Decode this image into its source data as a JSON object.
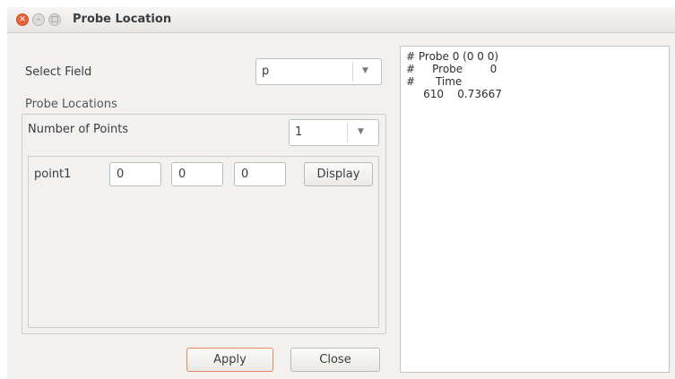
{
  "window": {
    "title": "Probe Location"
  },
  "select_field": {
    "label": "Select Field",
    "value": "p"
  },
  "probe_locations": {
    "label": "Probe Locations",
    "number_of_points_label": "Number of Points",
    "number_of_points_value": "1",
    "points": [
      {
        "label": "point1",
        "x": "0",
        "y": "0",
        "z": "0",
        "display_label": "Display"
      }
    ]
  },
  "buttons": {
    "apply": "Apply",
    "close": "Close"
  },
  "output": {
    "lines": [
      "# Probe 0 (0 0 0)",
      "#     Probe        0",
      "#      Time",
      "     610    0.73667"
    ]
  }
}
